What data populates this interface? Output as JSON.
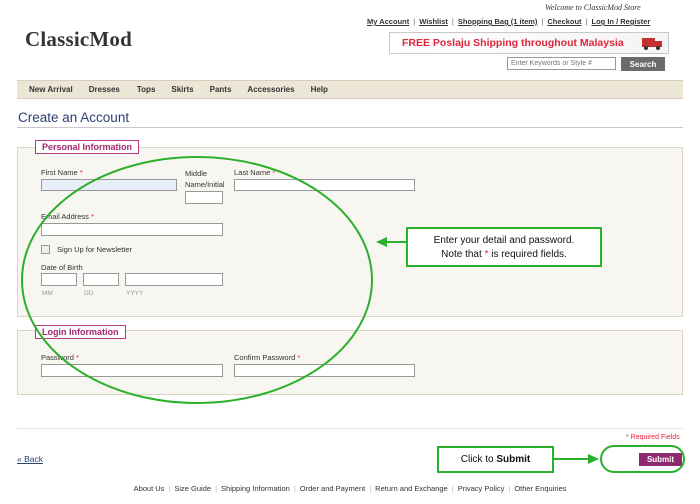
{
  "header": {
    "welcome": "Welcome to ClassicMod Store",
    "logo": "ClassicMod",
    "top_links": [
      "My Account",
      "Wishlist",
      "Shopping Bag (1 item)",
      "Checkout",
      "Log In / Register"
    ],
    "shipping_banner": "FREE Poslaju Shipping throughout Malaysia",
    "search_placeholder": "Enter Keywords or Style #",
    "search_button": "Search"
  },
  "nav": [
    "New Arrival",
    "Dresses",
    "Tops",
    "Skirts",
    "Pants",
    "Accessories",
    "Help"
  ],
  "page_title": "Create an Account",
  "personal": {
    "legend": "Personal Information",
    "first_name": "First Name",
    "middle_line1": "Middle",
    "middle_line2": "Name/Initial",
    "last_name": "Last Name",
    "email": "Email Address",
    "newsletter": "Sign Up for Newsletter",
    "dob": "Date of Birth",
    "mm": "MM",
    "dd": "DD",
    "yyyy": "YYYY",
    "required_mark": "*"
  },
  "login": {
    "legend": "Login Information",
    "password": "Password",
    "confirm_password": "Confirm Password"
  },
  "required_fields": "* Required Fields",
  "back_link": "« Back",
  "submit_button": "Submit",
  "footer_links": [
    "About Us",
    "Size Guide",
    "Shipping Information",
    "Order and Payment",
    "Return and Exchange",
    "Privacy Policy",
    "Other Enquiries"
  ],
  "annotations": {
    "callout1_line1": "Enter your detail and password.",
    "callout1_line2_pre": "Note that ",
    "callout1_line2_star": "*",
    "callout1_line2_post": " is required fields.",
    "callout2_pre": "Click to ",
    "callout2_bold": "Submit"
  },
  "colors": {
    "accent_magenta": "#8d2a6e",
    "required_red": "#e0253c",
    "annotation_green": "#2bb02b",
    "title_blue": "#2a3f6e"
  }
}
